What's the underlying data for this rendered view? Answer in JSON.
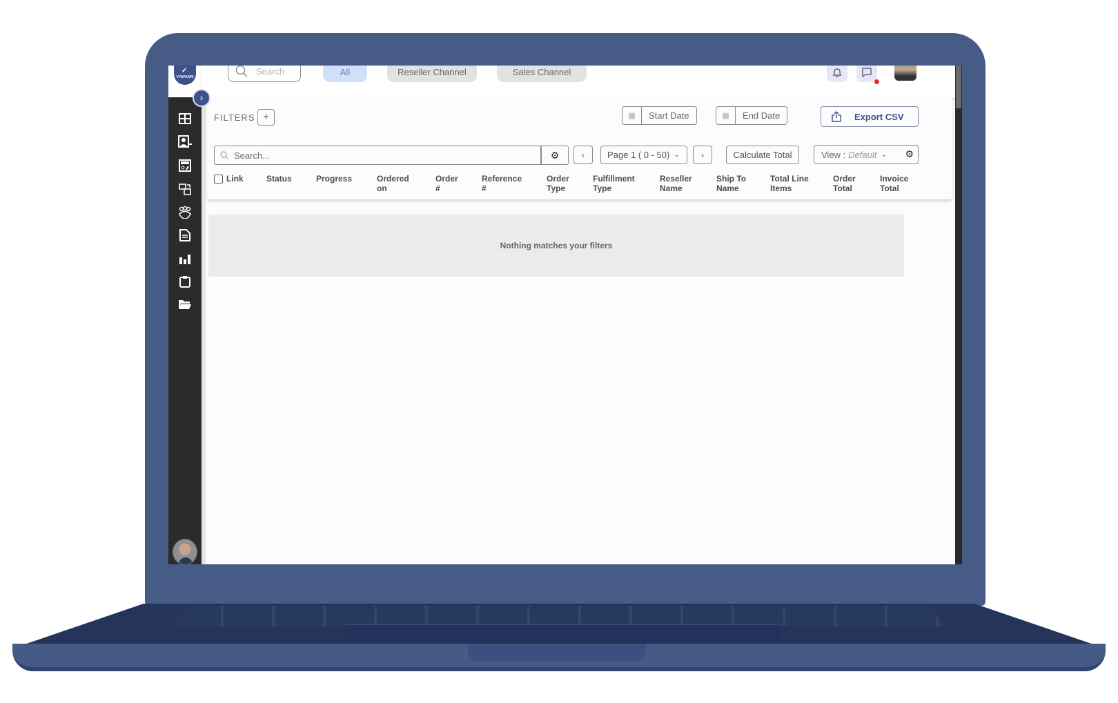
{
  "brand": {
    "logo_text": "VYAPAARI",
    "accent": "#3d5288"
  },
  "topbar": {
    "search_placeholder": "Search",
    "channel_tabs": [
      {
        "label": "All",
        "active": true
      },
      {
        "label": "Reseller Channel",
        "active": false
      },
      {
        "label": "Sales Channel",
        "active": false
      }
    ],
    "icons": [
      "bell-icon",
      "chat-icon",
      "user-avatar"
    ],
    "chat_has_notification": true
  },
  "sidebar": {
    "items": [
      {
        "icon": "dashboard-icon"
      },
      {
        "icon": "add-contact-icon"
      },
      {
        "icon": "catalog-icon"
      },
      {
        "icon": "transfer-icon"
      },
      {
        "icon": "team-icon"
      },
      {
        "icon": "document-icon"
      },
      {
        "icon": "bar-chart-icon"
      },
      {
        "icon": "clipboard-icon"
      },
      {
        "icon": "folder-open-icon"
      }
    ]
  },
  "filters": {
    "label": "FILTERS",
    "add_label": "+",
    "start_date": "Start Date",
    "end_date": "End Date",
    "export_label": "Export CSV"
  },
  "table_toolbar": {
    "search_placeholder": "Search...",
    "page_label": "Page 1 ( 0 -  50)",
    "calculate_label": "Calculate Total",
    "view_label": "View :",
    "view_value": "Default"
  },
  "table": {
    "columns": [
      {
        "line1": "Link",
        "line2": ""
      },
      {
        "line1": "Status",
        "line2": ""
      },
      {
        "line1": "Progress",
        "line2": ""
      },
      {
        "line1": "Ordered",
        "line2": "on"
      },
      {
        "line1": "Order",
        "line2": "#"
      },
      {
        "line1": "Reference",
        "line2": "#"
      },
      {
        "line1": "Order",
        "line2": "Type"
      },
      {
        "line1": "Fulfillment",
        "line2": "Type"
      },
      {
        "line1": "Reseller",
        "line2": "Name"
      },
      {
        "line1": "Ship To",
        "line2": "Name"
      },
      {
        "line1": "Total Line",
        "line2": "Items"
      },
      {
        "line1": "Order",
        "line2": "Total"
      },
      {
        "line1": "Invoice",
        "line2": "Total"
      }
    ],
    "rows": [],
    "empty_message": "Nothing matches your filters"
  }
}
